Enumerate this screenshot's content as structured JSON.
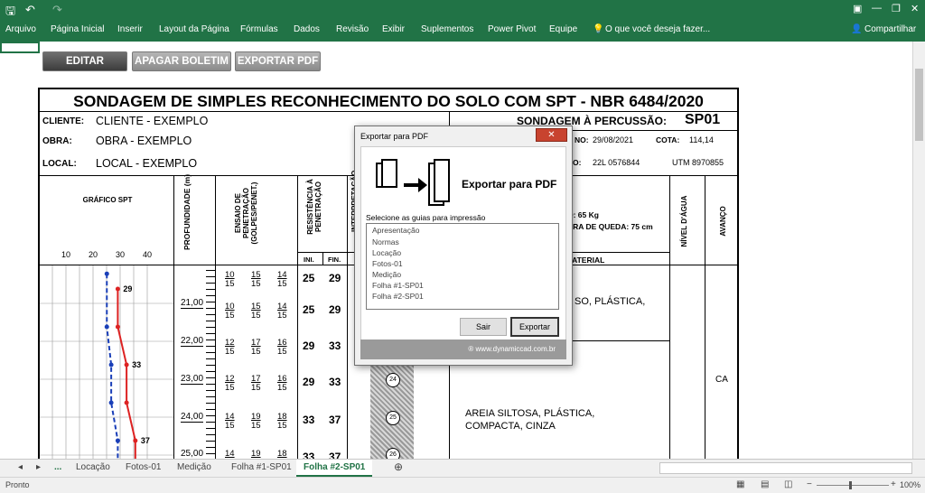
{
  "app": {
    "tabs": [
      "Arquivo",
      "Página Inicial",
      "Inserir",
      "Layout da Página",
      "Fórmulas",
      "Dados",
      "Revisão",
      "Exibir",
      "Suplementos",
      "Power Pivot",
      "Equipe"
    ],
    "tell_me": "O que você deseja fazer...",
    "share": "Compartilhar"
  },
  "toolbar": {
    "edit": "EDITAR",
    "delete": "APAGAR BOLETIM",
    "export": "EXPORTAR PDF"
  },
  "report": {
    "title": "SONDAGEM DE SIMPLES RECONHECIMENTO DO SOLO COM SPT - NBR 6484/2020",
    "client_label": "CLIENTE:",
    "client": "CLIENTE - EXEMPLO",
    "work_label": "OBRA:",
    "work": "OBRA - EXEMPLO",
    "local_label": "LOCAL:",
    "local": "LOCAL - EXEMPLO",
    "sondagem_label": "SONDAGEM À PERCUSSÃO:",
    "sondagem_id": "SP01",
    "date_label": "NO:",
    "date": "29/08/2021",
    "cota_label": "COTA:",
    "cota": "114,14",
    "coord_prefix": "O:",
    "coord_utm_zone": "22L 0576844",
    "coord_utm": "UTM 8970855",
    "peso": "O: 65 Kg",
    "altura": "URA DE QUEDA: 75 cm",
    "material_header": "MATERIAL",
    "col_grafico": "GRÁFICO SPT",
    "col_prof": "PROFUNDIDADE (m)",
    "col_ensaio": "ENSAIO DE PENETRAÇÃO (GOLPES/PENET.)",
    "col_resist": "RESISTÊNCIA À PENETRAÇÃO",
    "col_interp": "INTERPRETAÇÃO",
    "col_nivel": "NÍVEL D'ÁGUA",
    "col_avanco": "AVANÇO",
    "ini": "INI.",
    "fin": "FIN.",
    "axis_ticks": [
      "10",
      "20",
      "30",
      "40"
    ],
    "depths": [
      "21,00",
      "22,00",
      "23,00",
      "24,00",
      "25,00"
    ],
    "rows": [
      {
        "b": [
          "10",
          "15",
          "14"
        ],
        "p": [
          "15",
          "15",
          "15"
        ],
        "ini": "25",
        "fin": "29",
        "spt": "29"
      },
      {
        "b": [
          "10",
          "15",
          "14"
        ],
        "p": [
          "15",
          "15",
          "15"
        ],
        "ini": "25",
        "fin": "29",
        "spt": "29"
      },
      {
        "b": [
          "12",
          "17",
          "16"
        ],
        "p": [
          "15",
          "15",
          "15"
        ],
        "ini": "29",
        "fin": "33",
        "spt": "33"
      },
      {
        "b": [
          "12",
          "17",
          "16"
        ],
        "p": [
          "15",
          "15",
          "15"
        ],
        "ini": "29",
        "fin": "33",
        "spt": "33"
      },
      {
        "b": [
          "14",
          "19",
          "18"
        ],
        "p": [
          "15",
          "15",
          "15"
        ],
        "ini": "33",
        "fin": "37",
        "spt": "37"
      },
      {
        "b": [
          "14",
          "19",
          "18"
        ],
        "p": [
          "15",
          "15",
          "15"
        ],
        "ini": "33",
        "fin": "37",
        "spt": ""
      }
    ],
    "interp_numbers": [
      "24",
      "25",
      "26"
    ],
    "material1": "SO, PLÁSTICA,",
    "material2_line1": "AREIA SILTOSA, PLÁSTICA,",
    "material2_line2": "COMPACTA, CINZA",
    "avanco": "CA"
  },
  "dialog": {
    "title": "Exportar para PDF",
    "heading": "Exportar para PDF",
    "list_label": "Selecione as guias para impressão",
    "items": [
      "Apresentação",
      "Normas",
      "Locação",
      "Fotos-01",
      "Medição",
      "Folha #1-SP01",
      "Folha #2-SP01"
    ],
    "exit": "Sair",
    "export": "Exportar",
    "footer": "® www.dynamiccad.com.br"
  },
  "sheet_tabs": {
    "more": "...",
    "tabs": [
      "Locação",
      "Fotos-01",
      "Medição",
      "Folha #1-SP01",
      "Folha #2-SP01"
    ],
    "active": "Folha #2-SP01"
  },
  "status": {
    "ready": "Pronto",
    "zoom": "100%"
  },
  "chart_data": {
    "type": "line",
    "xlim": [
      0,
      50
    ],
    "series": [
      {
        "name": "",
        "x": [
          29,
          29,
          33,
          33,
          37,
          37
        ],
        "y": [
          20.5,
          21.5,
          22.5,
          23.5,
          24.5,
          25.2
        ]
      },
      {
        "name": "",
        "x": [
          24,
          24,
          26,
          26,
          29,
          29
        ],
        "y": [
          20.1,
          21.5,
          22.5,
          23.5,
          24.5,
          25.2
        ]
      }
    ]
  }
}
